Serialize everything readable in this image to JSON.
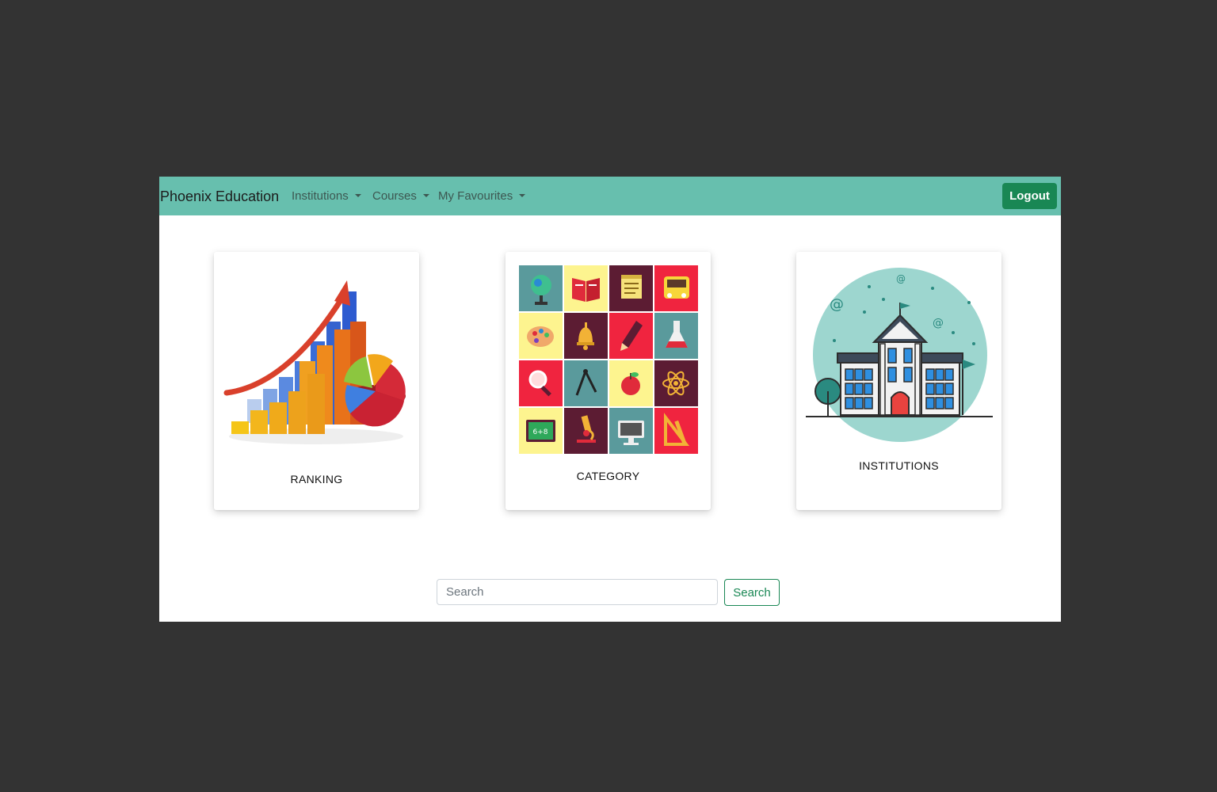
{
  "navbar": {
    "brand": "Phoenix Education",
    "items": [
      {
        "label": "Institutions"
      },
      {
        "label": "Courses"
      },
      {
        "label": "My Favourites"
      }
    ],
    "logout_label": "Logout",
    "color": "#67bfae"
  },
  "cards": [
    {
      "label": "RANKING",
      "icon": "bar-chart-growth-icon"
    },
    {
      "label": "CATEGORY",
      "icon": "education-tiles-icon"
    },
    {
      "label": "INSTITUTIONS",
      "icon": "school-building-icon"
    }
  ],
  "search": {
    "placeholder": "Search",
    "button_label": "Search",
    "accent": "#198754"
  }
}
